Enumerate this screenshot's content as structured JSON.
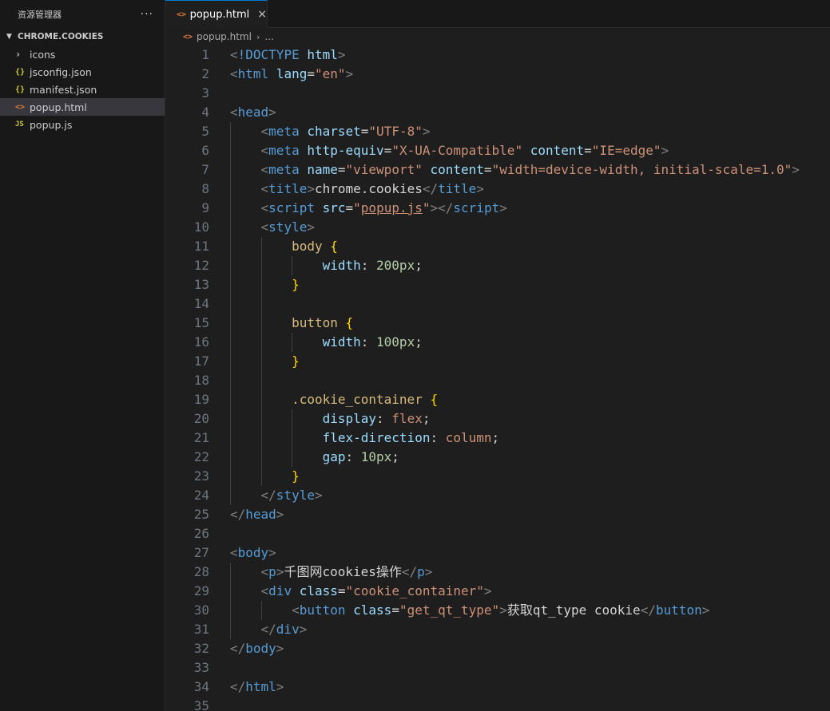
{
  "colors": {
    "accent": "#0078d4",
    "tag": "#569cd6",
    "attribute": "#9cdcfe",
    "string": "#ce9178",
    "number": "#b5cea8",
    "selector": "#d7ba7d",
    "brace": "#ffd700"
  },
  "sidebar": {
    "title": "资源管理器",
    "more_icon": "ellipsis-icon",
    "section": "CHROME.COOKIES",
    "items": [
      {
        "label": "icons",
        "icon": "folder-chevron-icon"
      },
      {
        "label": "jsconfig.json",
        "icon": "json-icon"
      },
      {
        "label": "manifest.json",
        "icon": "json-icon"
      },
      {
        "label": "popup.html",
        "icon": "html-icon",
        "active": true
      },
      {
        "label": "popup.js",
        "icon": "js-icon"
      }
    ]
  },
  "tabs": [
    {
      "label": "popup.html",
      "icon": "html-icon",
      "close": "×"
    }
  ],
  "breadcrumb": {
    "file": "popup.html",
    "trail": "..."
  },
  "editor": {
    "line_numbers": [
      "1",
      "2",
      "3",
      "4",
      "5",
      "6",
      "7",
      "8",
      "9",
      "10",
      "11",
      "12",
      "13",
      "14",
      "15",
      "16",
      "17",
      "18",
      "19",
      "20",
      "21",
      "22",
      "23",
      "24",
      "25",
      "26",
      "27",
      "28",
      "29",
      "30",
      "31",
      "32",
      "33",
      "34",
      "35"
    ],
    "lines": [
      [
        [
          "t-punct",
          "<"
        ],
        [
          "t-tag",
          "!DOCTYPE"
        ],
        [
          "t-text",
          " "
        ],
        [
          "t-attr",
          "html"
        ],
        [
          "t-punct",
          ">"
        ]
      ],
      [
        [
          "t-punct",
          "<"
        ],
        [
          "t-tag",
          "html"
        ],
        [
          "t-text",
          " "
        ],
        [
          "t-attr",
          "lang"
        ],
        [
          "t-text",
          "="
        ],
        [
          "t-str",
          "\"en\""
        ],
        [
          "t-punct",
          ">"
        ]
      ],
      [],
      [
        [
          "t-punct",
          "<"
        ],
        [
          "t-tag",
          "head"
        ],
        [
          "t-punct",
          ">"
        ]
      ],
      [
        [
          "t-text",
          "    "
        ],
        [
          "t-punct",
          "<"
        ],
        [
          "t-tag",
          "meta"
        ],
        [
          "t-text",
          " "
        ],
        [
          "t-attr",
          "charset"
        ],
        [
          "t-text",
          "="
        ],
        [
          "t-str",
          "\"UTF-8\""
        ],
        [
          "t-punct",
          ">"
        ]
      ],
      [
        [
          "t-text",
          "    "
        ],
        [
          "t-punct",
          "<"
        ],
        [
          "t-tag",
          "meta"
        ],
        [
          "t-text",
          " "
        ],
        [
          "t-attr",
          "http-equiv"
        ],
        [
          "t-text",
          "="
        ],
        [
          "t-str",
          "\"X-UA-Compatible\""
        ],
        [
          "t-text",
          " "
        ],
        [
          "t-attr",
          "content"
        ],
        [
          "t-text",
          "="
        ],
        [
          "t-str",
          "\"IE=edge\""
        ],
        [
          "t-punct",
          ">"
        ]
      ],
      [
        [
          "t-text",
          "    "
        ],
        [
          "t-punct",
          "<"
        ],
        [
          "t-tag",
          "meta"
        ],
        [
          "t-text",
          " "
        ],
        [
          "t-attr",
          "name"
        ],
        [
          "t-text",
          "="
        ],
        [
          "t-str",
          "\"viewport\""
        ],
        [
          "t-text",
          " "
        ],
        [
          "t-attr",
          "content"
        ],
        [
          "t-text",
          "="
        ],
        [
          "t-str",
          "\"width=device-width, initial-scale=1.0\""
        ],
        [
          "t-punct",
          ">"
        ]
      ],
      [
        [
          "t-text",
          "    "
        ],
        [
          "t-punct",
          "<"
        ],
        [
          "t-tag",
          "title"
        ],
        [
          "t-punct",
          ">"
        ],
        [
          "t-text",
          "chrome.cookies"
        ],
        [
          "t-punct",
          "</"
        ],
        [
          "t-tag",
          "title"
        ],
        [
          "t-punct",
          ">"
        ]
      ],
      [
        [
          "t-text",
          "    "
        ],
        [
          "t-punct",
          "<"
        ],
        [
          "t-tag",
          "script"
        ],
        [
          "t-text",
          " "
        ],
        [
          "t-attr",
          "src"
        ],
        [
          "t-text",
          "="
        ],
        [
          "t-str",
          "\""
        ],
        [
          "t-link",
          "popup.js"
        ],
        [
          "t-str",
          "\""
        ],
        [
          "t-punct",
          "></"
        ],
        [
          "t-tag",
          "script"
        ],
        [
          "t-punct",
          ">"
        ]
      ],
      [
        [
          "t-text",
          "    "
        ],
        [
          "t-punct",
          "<"
        ],
        [
          "t-tag",
          "style"
        ],
        [
          "t-punct",
          ">"
        ]
      ],
      [
        [
          "t-text",
          "        "
        ],
        [
          "t-sel",
          "body"
        ],
        [
          "t-text",
          " "
        ],
        [
          "t-brace",
          "{"
        ]
      ],
      [
        [
          "t-text",
          "            "
        ],
        [
          "t-prop",
          "width"
        ],
        [
          "t-text",
          ": "
        ],
        [
          "t-num",
          "200px"
        ],
        [
          "t-text",
          ";"
        ]
      ],
      [
        [
          "t-text",
          "        "
        ],
        [
          "t-brace",
          "}"
        ]
      ],
      [],
      [
        [
          "t-text",
          "        "
        ],
        [
          "t-sel",
          "button"
        ],
        [
          "t-text",
          " "
        ],
        [
          "t-brace",
          "{"
        ]
      ],
      [
        [
          "t-text",
          "            "
        ],
        [
          "t-prop",
          "width"
        ],
        [
          "t-text",
          ": "
        ],
        [
          "t-num",
          "100px"
        ],
        [
          "t-text",
          ";"
        ]
      ],
      [
        [
          "t-text",
          "        "
        ],
        [
          "t-brace",
          "}"
        ]
      ],
      [],
      [
        [
          "t-text",
          "        "
        ],
        [
          "t-sel",
          ".cookie_container"
        ],
        [
          "t-text",
          " "
        ],
        [
          "t-brace",
          "{"
        ]
      ],
      [
        [
          "t-text",
          "            "
        ],
        [
          "t-prop",
          "display"
        ],
        [
          "t-text",
          ": "
        ],
        [
          "t-val",
          "flex"
        ],
        [
          "t-text",
          ";"
        ]
      ],
      [
        [
          "t-text",
          "            "
        ],
        [
          "t-prop",
          "flex-direction"
        ],
        [
          "t-text",
          ": "
        ],
        [
          "t-val",
          "column"
        ],
        [
          "t-text",
          ";"
        ]
      ],
      [
        [
          "t-text",
          "            "
        ],
        [
          "t-prop",
          "gap"
        ],
        [
          "t-text",
          ": "
        ],
        [
          "t-num",
          "10px"
        ],
        [
          "t-text",
          ";"
        ]
      ],
      [
        [
          "t-text",
          "        "
        ],
        [
          "t-brace",
          "}"
        ]
      ],
      [
        [
          "t-text",
          "    "
        ],
        [
          "t-punct",
          "</"
        ],
        [
          "t-tag",
          "style"
        ],
        [
          "t-punct",
          ">"
        ]
      ],
      [
        [
          "t-punct",
          "</"
        ],
        [
          "t-tag",
          "head"
        ],
        [
          "t-punct",
          ">"
        ]
      ],
      [],
      [
        [
          "t-punct",
          "<"
        ],
        [
          "t-tag",
          "body"
        ],
        [
          "t-punct",
          ">"
        ]
      ],
      [
        [
          "t-text",
          "    "
        ],
        [
          "t-punct",
          "<"
        ],
        [
          "t-tag",
          "p"
        ],
        [
          "t-punct",
          ">"
        ],
        [
          "t-text",
          "千图网cookies操作"
        ],
        [
          "t-punct",
          "</"
        ],
        [
          "t-tag",
          "p"
        ],
        [
          "t-punct",
          ">"
        ]
      ],
      [
        [
          "t-text",
          "    "
        ],
        [
          "t-punct",
          "<"
        ],
        [
          "t-tag",
          "div"
        ],
        [
          "t-text",
          " "
        ],
        [
          "t-attr",
          "class"
        ],
        [
          "t-text",
          "="
        ],
        [
          "t-str",
          "\"cookie_container\""
        ],
        [
          "t-punct",
          ">"
        ]
      ],
      [
        [
          "t-text",
          "        "
        ],
        [
          "t-punct",
          "<"
        ],
        [
          "t-tag",
          "button"
        ],
        [
          "t-text",
          " "
        ],
        [
          "t-attr",
          "class"
        ],
        [
          "t-text",
          "="
        ],
        [
          "t-str",
          "\"get_qt_type\""
        ],
        [
          "t-punct",
          ">"
        ],
        [
          "t-text",
          "获取qt_type cookie"
        ],
        [
          "t-punct",
          "</"
        ],
        [
          "t-tag",
          "button"
        ],
        [
          "t-punct",
          ">"
        ]
      ],
      [
        [
          "t-text",
          "    "
        ],
        [
          "t-punct",
          "</"
        ],
        [
          "t-tag",
          "div"
        ],
        [
          "t-punct",
          ">"
        ]
      ],
      [
        [
          "t-punct",
          "</"
        ],
        [
          "t-tag",
          "body"
        ],
        [
          "t-punct",
          ">"
        ]
      ],
      [],
      [
        [
          "t-punct",
          "</"
        ],
        [
          "t-tag",
          "html"
        ],
        [
          "t-punct",
          ">"
        ]
      ],
      []
    ]
  }
}
